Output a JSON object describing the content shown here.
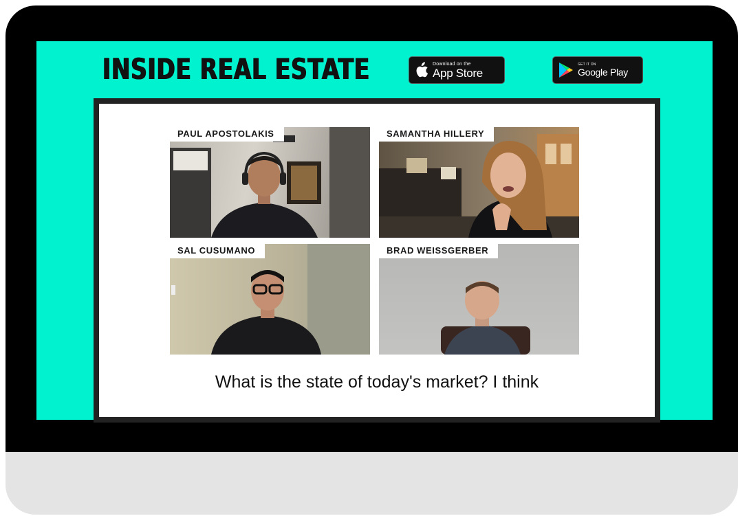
{
  "show": {
    "logo_text": "INSIDE REAL ESTATE"
  },
  "badges": {
    "appstore": {
      "small": "Download on the",
      "big": "App Store",
      "icon": "apple-icon"
    },
    "google": {
      "small": "GET IT ON",
      "big": "Google Play",
      "icon": "play-triangle-icon"
    }
  },
  "participants": [
    {
      "name": "PAUL APOSTOLAKIS"
    },
    {
      "name": "SAMANTHA HILLERY"
    },
    {
      "name": "SAL CUSUMANO"
    },
    {
      "name": "BRAD WEISSGERBER"
    }
  ],
  "caption": "What is the state of today's market? I think",
  "colors": {
    "accent": "#00f2cf",
    "frame": "#000000",
    "panel_border": "#222222"
  }
}
